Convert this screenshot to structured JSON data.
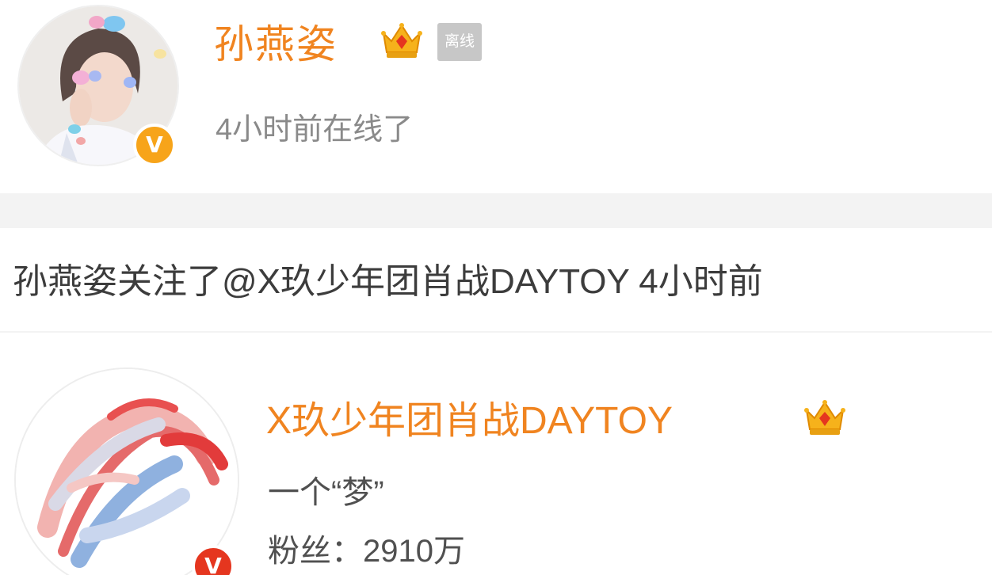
{
  "profile": {
    "name": "孙燕姿",
    "status_tag": "离线",
    "last_online": "4小时前在线了",
    "verified_badge": "V",
    "crown_icon": "crown-icon"
  },
  "activity": {
    "text": "孙燕姿关注了@X玖少年团肖战DAYTOY 4小时前"
  },
  "followed_account": {
    "name": "X玖少年团肖战DAYTOY",
    "bio": "一个“梦”",
    "fans_label": "粉丝：",
    "fans_count": "2910万",
    "verified_badge": "V",
    "crown_icon": "crown-icon"
  },
  "colors": {
    "name_orange": "#f08420",
    "badge_gold": "#f7a41a",
    "badge_red": "#e5361f",
    "tag_gray": "#c7c7c7",
    "divider_gray": "#f3f3f3"
  }
}
